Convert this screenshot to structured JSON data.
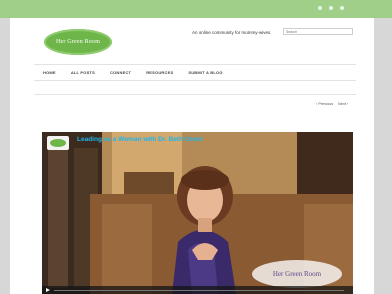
{
  "header": {
    "logo_text": "Her Green Room",
    "tagline": "An online community for mommy-wives.",
    "search_placeholder": "Search"
  },
  "nav": {
    "items": [
      "HOME",
      "ALL POSTS",
      "CONNECT",
      "RESOURCES",
      "SUBMIT A BLOG"
    ]
  },
  "pager": {
    "prev_label": "‹ Previous",
    "next_label": "Next ›"
  },
  "video": {
    "title": "Leading as a Woman with Dr. Beth Grant",
    "watermark": "Her Green Room"
  },
  "icons": {
    "play": "play-icon"
  },
  "colors": {
    "top_bar": "#9fcf88",
    "logo": "#6fb64a",
    "video_title": "#1bb6ec"
  }
}
